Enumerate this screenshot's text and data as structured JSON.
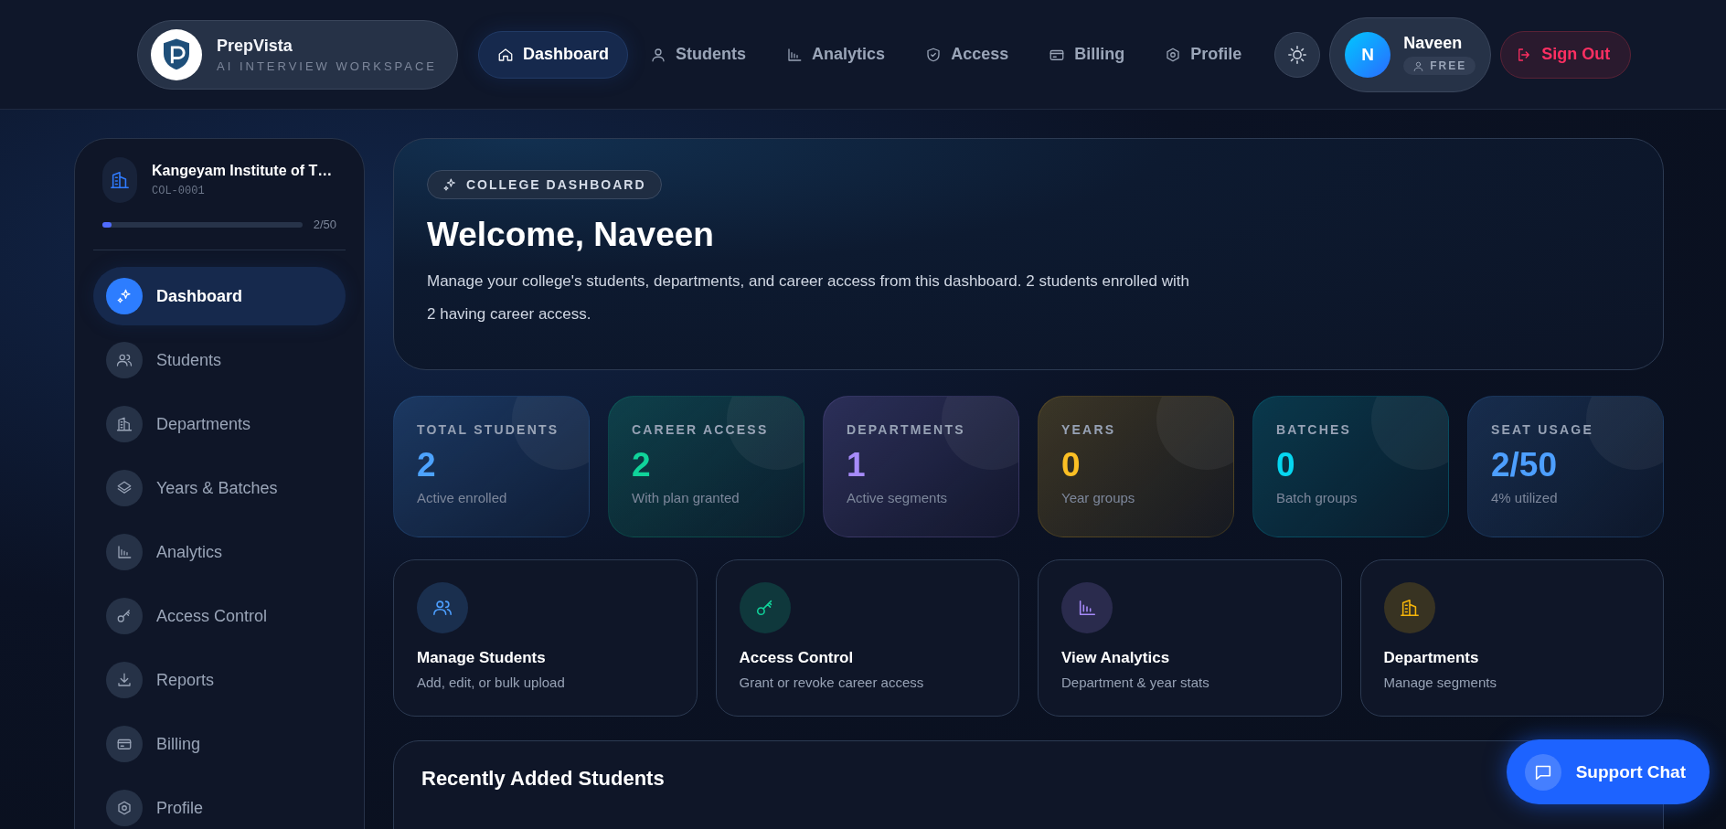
{
  "brand": {
    "name": "PrepVista",
    "tagline": "AI INTERVIEW WORKSPACE"
  },
  "nav": [
    {
      "label": "Dashboard",
      "selected": true
    },
    {
      "label": "Students",
      "selected": false
    },
    {
      "label": "Analytics",
      "selected": false
    },
    {
      "label": "Access",
      "selected": false
    },
    {
      "label": "Billing",
      "selected": false
    },
    {
      "label": "Profile",
      "selected": false
    }
  ],
  "user": {
    "initial": "N",
    "name": "Naveen",
    "plan": "FREE"
  },
  "sign_out": "Sign Out",
  "sidebar": {
    "college": "Kangeyam Institute of T…",
    "code": "COL-0001",
    "seats": {
      "level": 0.04,
      "reading": "2/50"
    },
    "items": [
      {
        "label": "Dashboard",
        "selected": true
      },
      {
        "label": "Students",
        "selected": false
      },
      {
        "label": "Departments",
        "selected": false
      },
      {
        "label": "Years & Batches",
        "selected": false
      },
      {
        "label": "Analytics",
        "selected": false
      },
      {
        "label": "Access Control",
        "selected": false
      },
      {
        "label": "Reports",
        "selected": false
      },
      {
        "label": "Billing",
        "selected": false
      },
      {
        "label": "Profile",
        "selected": false
      }
    ]
  },
  "welcome": {
    "badge": "COLLEGE DASHBOARD",
    "title": "Welcome, Naveen",
    "text": "Manage your college's students, departments, and career access from this dashboard. 2 students enrolled with 2 having career access."
  },
  "stats": [
    {
      "label": "TOTAL STUDENTS",
      "value": "2",
      "caption": "Active enrolled",
      "color": "#4da3ff"
    },
    {
      "label": "CAREER ACCESS",
      "value": "2",
      "caption": "With plan granted",
      "color": "#10d39a"
    },
    {
      "label": "DEPARTMENTS",
      "value": "1",
      "caption": "Active segments",
      "color": "#a78bfa"
    },
    {
      "label": "YEARS",
      "value": "0",
      "caption": "Year groups",
      "color": "#fbbf24"
    },
    {
      "label": "BATCHES",
      "value": "0",
      "caption": "Batch groups",
      "color": "#06d6f0"
    },
    {
      "label": "SEAT USAGE",
      "value": "2/50",
      "caption": "4% utilized",
      "color": "#4d9fff"
    }
  ],
  "actions": [
    {
      "title": "Manage Students",
      "subtitle": "Add, edit, or bulk upload",
      "color": "#4d9fff"
    },
    {
      "title": "Access Control",
      "subtitle": "Grant or revoke career access",
      "color": "#10d39a"
    },
    {
      "title": "View Analytics",
      "subtitle": "Department & year stats",
      "color": "#a78bfa"
    },
    {
      "title": "Departments",
      "subtitle": "Manage segments",
      "color": "#f5b50a"
    }
  ],
  "recent": {
    "title": "Recently Added Students"
  },
  "support_chat": "Support Chat"
}
